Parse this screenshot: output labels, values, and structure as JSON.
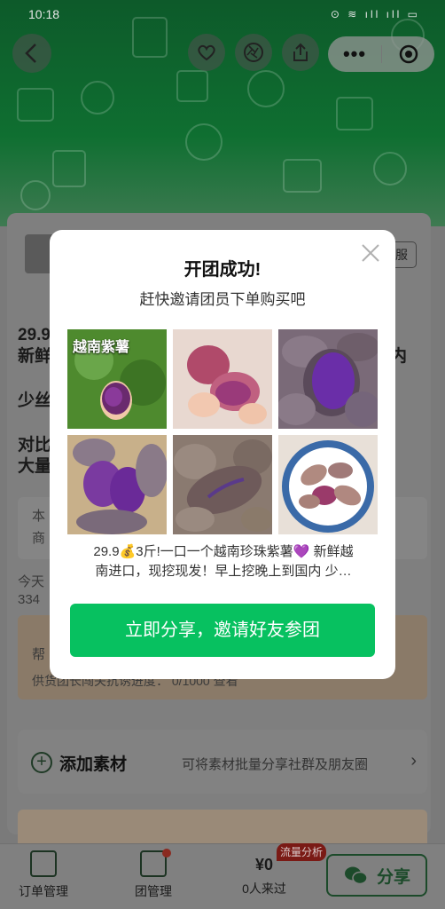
{
  "status_bar": {
    "time": "10:18",
    "indicators": "⊙ ≋ ıll ıll ▭"
  },
  "store": {
    "button_label": "服"
  },
  "background": {
    "line1": "29.9",
    "line2": "新鲜",
    "line2_right": "内",
    "line3": "少丝",
    "line4": "对比",
    "line5": "大量",
    "box_line1": "本",
    "box_line2": "商",
    "stats_line1": "今天",
    "stats_line2": "334",
    "help_text": "帮",
    "progress_text": "供货团长闯关抗诱进度： 0/1000 查看"
  },
  "add_material": {
    "title": "添加素材",
    "description": "可将素材批量分享社群及朋友圈",
    "arrow": "›"
  },
  "tabbar": {
    "order_label": "订单管理",
    "group_label": "团管理",
    "visit_amount": "¥0",
    "visit_label": "0人来过",
    "flow_badge": "流量分析",
    "share_label": "分享"
  },
  "modal": {
    "title": "开团成功!",
    "subtitle": "赶快邀请团员下单购买吧",
    "first_image_label": "越南紫薯",
    "description_line1": "29.9💰3斤!一口一个越南珍珠紫薯💜 新鲜越",
    "description_line2": "南进口，现挖现发！早上挖晚上到国内 少…",
    "cta_label": "立即分享，邀请好友参团"
  },
  "colors": {
    "accent_green": "#07c160",
    "hero_green": "#0f6f31"
  }
}
